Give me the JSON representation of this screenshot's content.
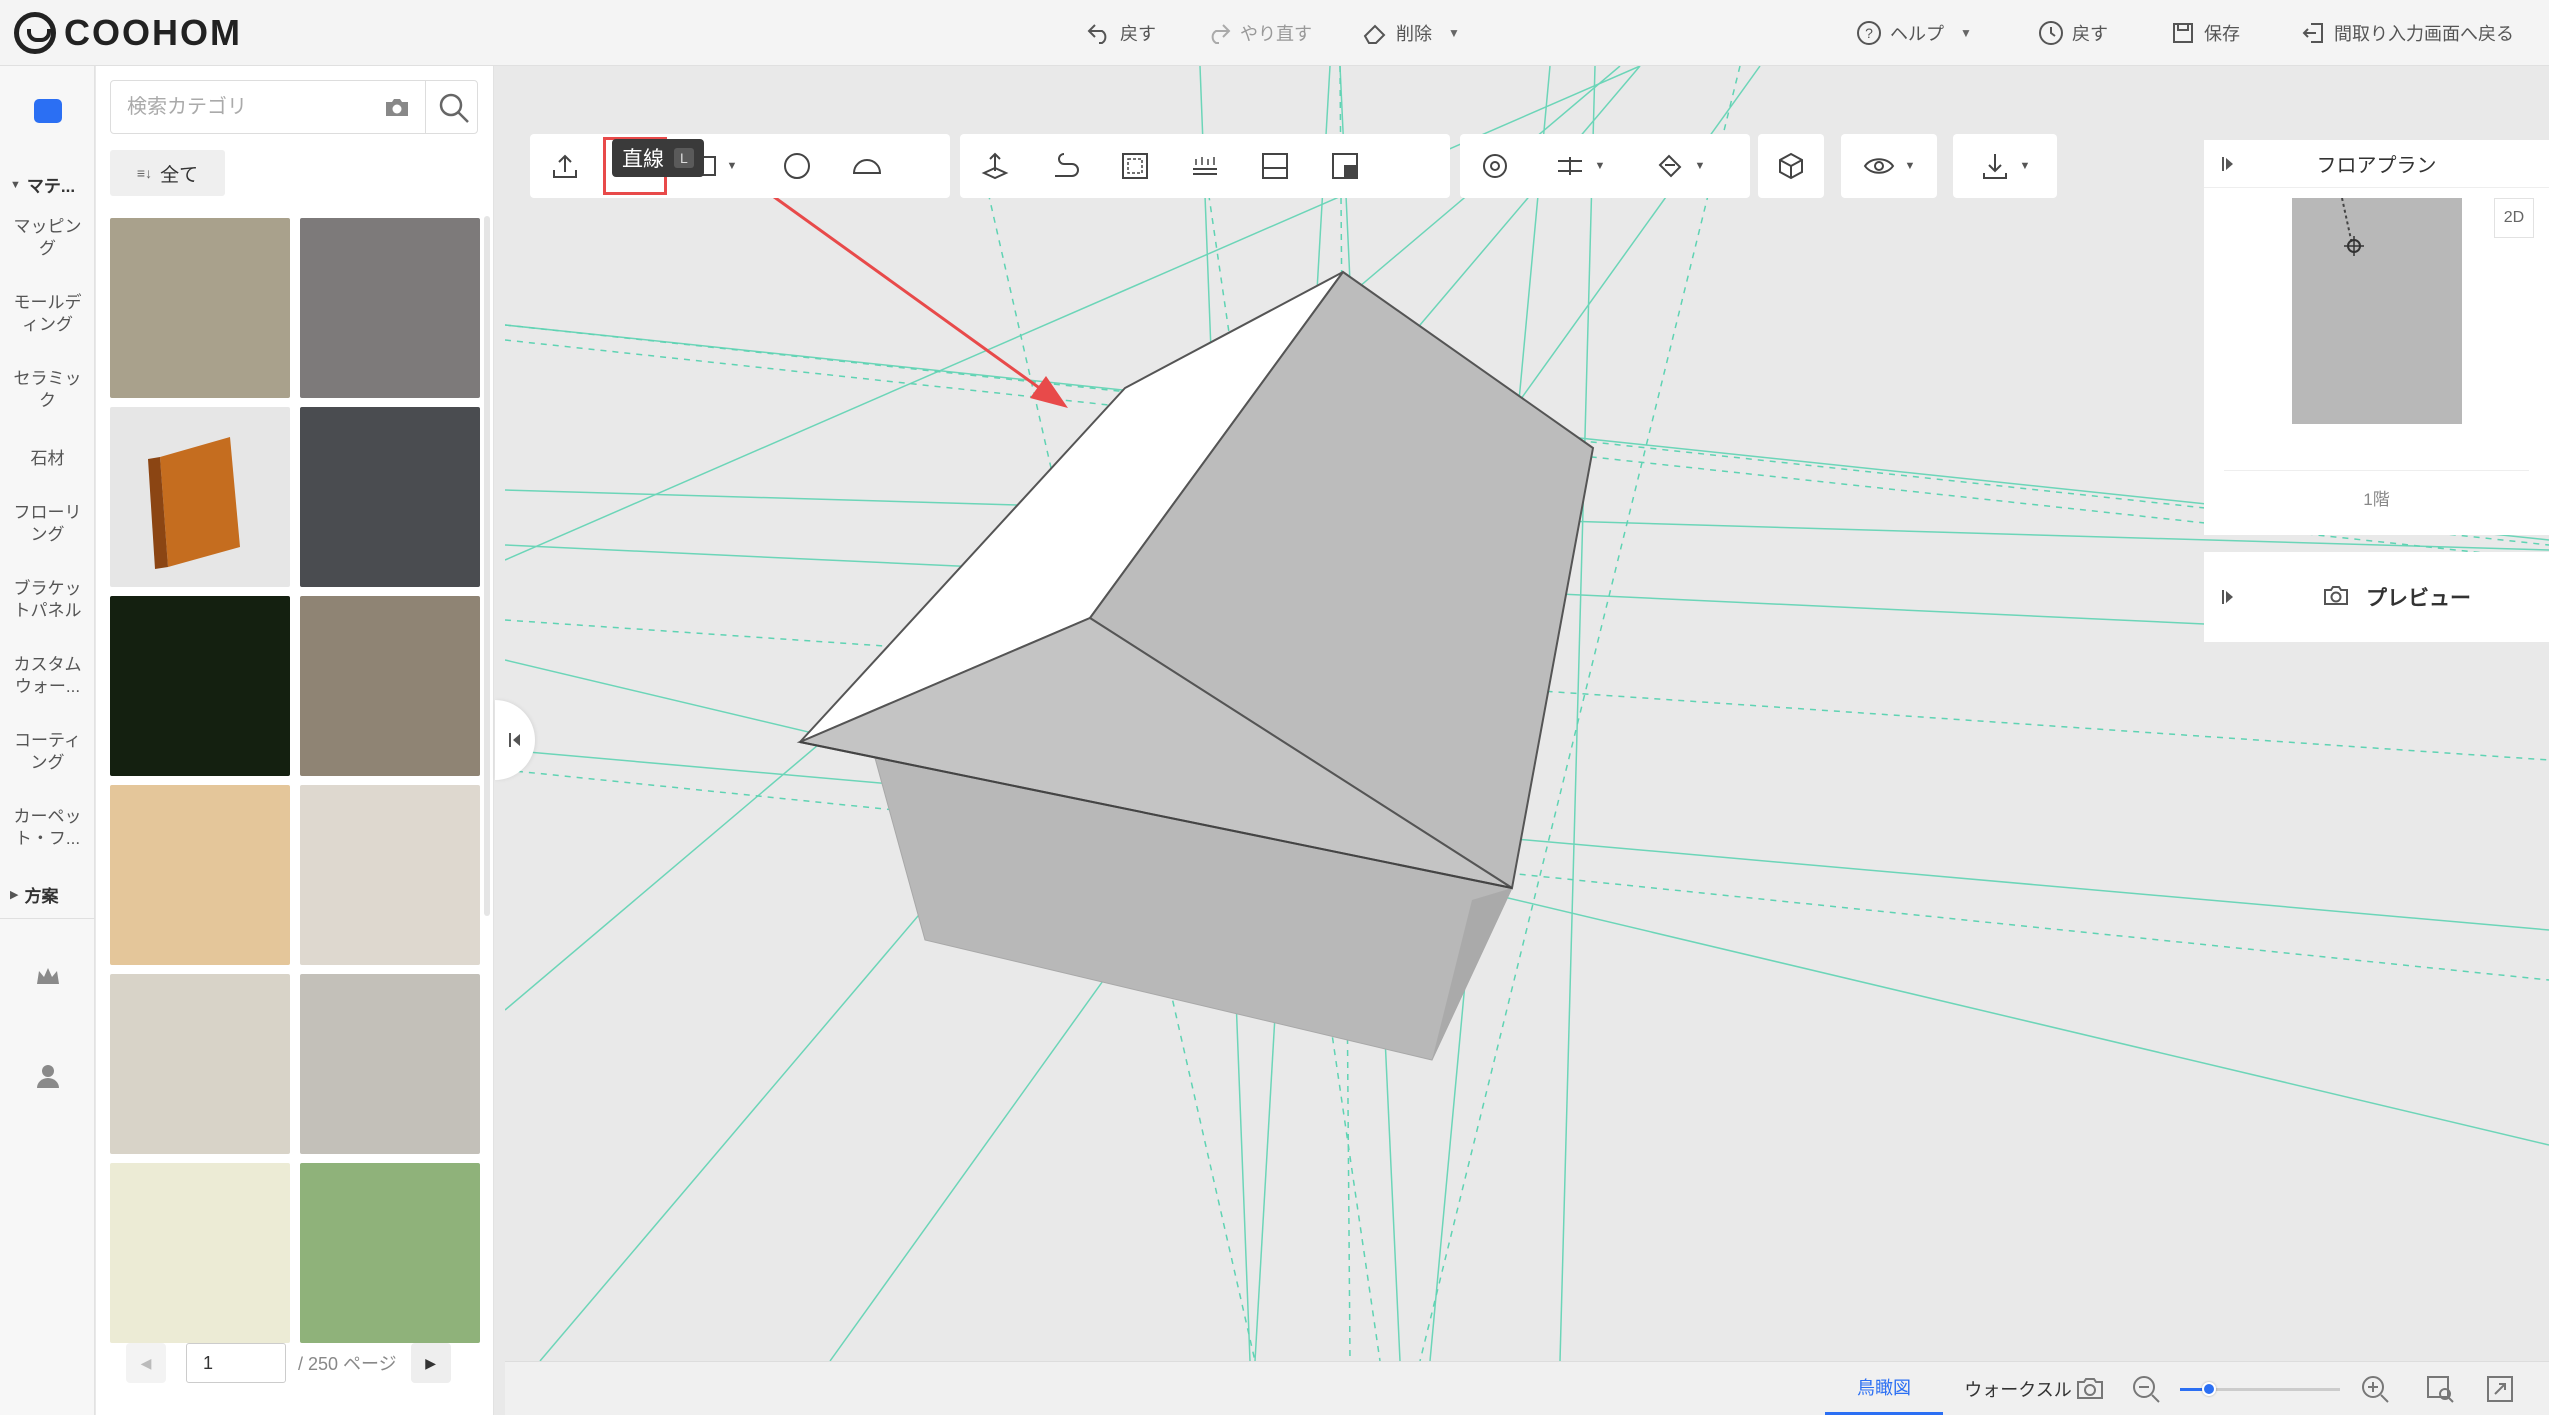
{
  "app": {
    "logo_text": "COOHOM"
  },
  "header": {
    "undo_label": "戻す",
    "redo_label": "やり直す",
    "delete_label": "削除",
    "help_label": "ヘルプ",
    "history_label": "戻す",
    "save_label": "保存",
    "back_to_floorplan_label": "間取り入力画面へ戻る"
  },
  "rail": {
    "section_materials": "マテ...",
    "items": [
      "マッピング",
      "モールディング",
      "セラミック",
      "石材",
      "フローリング",
      "ブラケットパネル",
      "カスタムウォー...",
      "コーティング",
      "カーペット・フ..."
    ],
    "section_plans": "方案"
  },
  "panel": {
    "search_placeholder": "検索カテゴリ",
    "filter_label": "全て",
    "tiles": [
      {
        "name": "weathered-wood",
        "color": "#a9a18c"
      },
      {
        "name": "gray-fabric",
        "color": "#7d7a7a"
      },
      {
        "name": "wood-baseboard",
        "color": "#e6e6e6"
      },
      {
        "name": "dark-concrete",
        "color": "#4a4c50"
      },
      {
        "name": "dark-green",
        "color": "#142010"
      },
      {
        "name": "light-oak-planks",
        "color": "#8f8474"
      },
      {
        "name": "maple",
        "color": "#e4c69a"
      },
      {
        "name": "marble-tile",
        "color": "#ded8cf"
      },
      {
        "name": "light-ash",
        "color": "#d8d3c8"
      },
      {
        "name": "linen-gray",
        "color": "#c3c0b9"
      },
      {
        "name": "plaid-fabric",
        "color": "#ecebd5"
      },
      {
        "name": "green-paint",
        "color": "#8fb27a"
      }
    ],
    "pager": {
      "current_page": "1",
      "total_label": "/ 250 ページ"
    }
  },
  "toolbar": {
    "tooltip_label": "直線",
    "tooltip_key": "L",
    "active_tool": "line-tool"
  },
  "floorplan": {
    "title": "フロアプラン",
    "badge": "2D",
    "floor_label": "1階"
  },
  "preview": {
    "label": "プレビュー"
  },
  "bottom": {
    "tab_birdseye": "鳥瞰図",
    "tab_walkthrough": "ウォークスル",
    "zoom_level": 0.18
  },
  "colors": {
    "accent": "#2b6ff3",
    "highlight": "#e84a4a",
    "guide_line": "#5fd3b3"
  }
}
